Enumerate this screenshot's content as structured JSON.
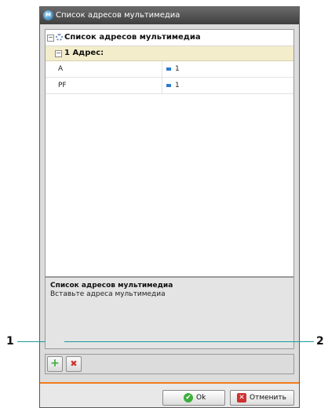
{
  "window": {
    "title": "Список адресов мультимедиа",
    "app_icon": "app-logo-icon"
  },
  "tree": {
    "root_label": "Список адресов мультимедиа",
    "group_label": "1 Адрес:",
    "rows": [
      {
        "name": "A",
        "value": "1"
      },
      {
        "name": "PF",
        "value": "1"
      }
    ]
  },
  "description": {
    "title": "Список адресов мультимедиа",
    "text": "Вставьте адреса мультимедиа"
  },
  "toolbar": {
    "add_icon": "+",
    "delete_icon": "✖"
  },
  "footer": {
    "ok_label": "Ok",
    "cancel_label": "Отменить"
  },
  "callouts": {
    "left": "1",
    "right": "2"
  },
  "colors": {
    "add": "#3cae3c",
    "delete": "#d03030",
    "accent": "#f27b1a",
    "callout": "#1b9aa0"
  }
}
